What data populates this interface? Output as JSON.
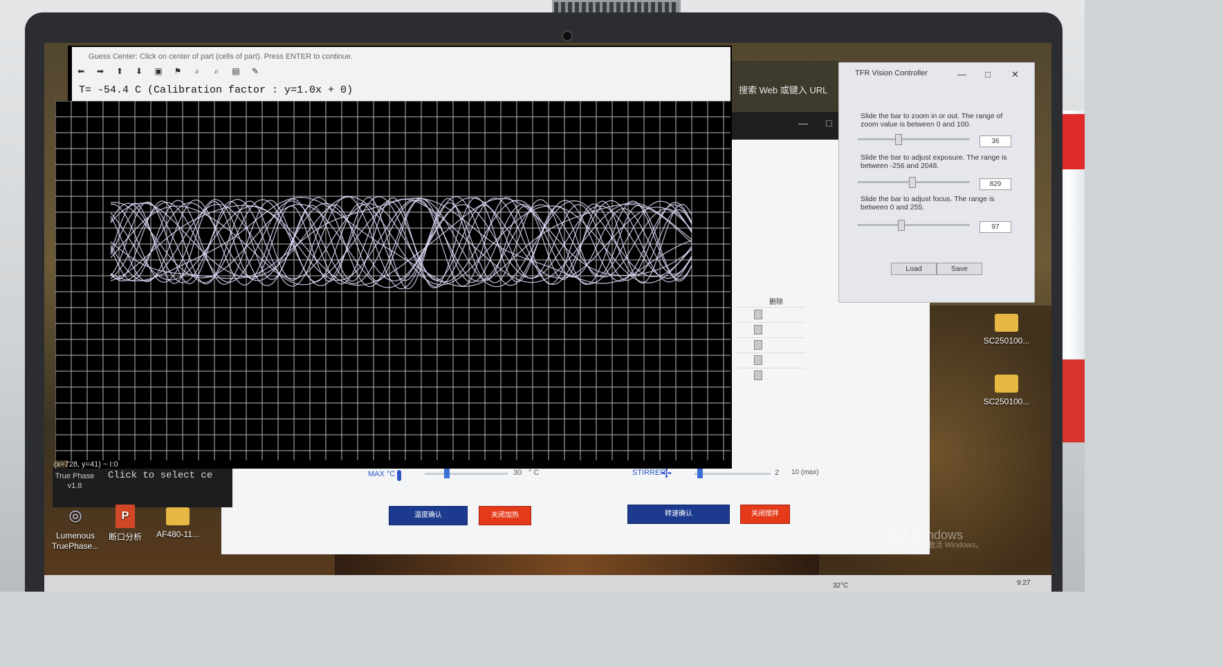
{
  "graph_window": {
    "title": "Guess Center: Click on center of part (cells of part). Press ENTER to continue.",
    "header": "T= -54.4 C    (Calibration factor : y=1.0x + 0)",
    "toolbar_icons": [
      "arrow-left-icon",
      "arrow-right-icon",
      "arrow-up-icon",
      "arrow-down-icon",
      "box-icon",
      "comment-icon",
      "zoom-in-icon",
      "zoom-out-icon",
      "save-icon",
      "brush-icon"
    ],
    "status": "(x=728, y=41) ~ I:0",
    "win_ctrl": [
      "—",
      "□",
      "✕"
    ]
  },
  "terminal": {
    "side_label_1": "True Phase",
    "side_label_2": "v1.8",
    "text": "Click to select ce"
  },
  "browser": {
    "address_placeholder": "搜索 Web 或键入 URL"
  },
  "app_window": {
    "table_header": "删除",
    "max_label": "MAX °C",
    "max_value": "30",
    "max_unit": "° C",
    "stirrer_label": "STIRRER",
    "stirrer_value": "2",
    "stirrer_max": "10  (max)",
    "btn_confirm_temp": "温度确认",
    "btn_close_heat": "关闭加热",
    "btn_confirm_speed": "转速确认",
    "btn_close_stir": "关闭搅拌"
  },
  "tfr": {
    "title": "TFR Vision Controller",
    "zoom_text": "Slide the bar to zoom in or out. The range of zoom value is between 0 and 100.",
    "zoom_value": "36",
    "zoom_level": 0.36,
    "exposure_text": "Slide the bar to adjust exposure. The range is between -256 and 2048.",
    "exposure_value": "829",
    "focus_text": "Slide the bar to adjust focus. The range is between 0 and 255.",
    "focus_value": "97",
    "load": "Load",
    "save": "Save",
    "ctrl": [
      "—",
      "□",
      "✕"
    ]
  },
  "desktop": {
    "icons": [
      {
        "label": "Lumenous TruePhase...",
        "kind": "lum"
      },
      {
        "label": "断口分析",
        "kind": "ppt"
      },
      {
        "label": "AF480-11...",
        "kind": "folder"
      },
      {
        "label": "SC250100...",
        "kind": "folder"
      },
      {
        "label": "SC250100...",
        "kind": "folder"
      }
    ],
    "watermark": "激活 Windows",
    "watermark_sub": "转到\"设置\"以激活 Windows。"
  },
  "taskbar": {
    "temp": "32°C",
    "time": "9:27"
  },
  "colors": {
    "graph_bg": "#000000",
    "grid": "#bcbcbc",
    "trace": "#e6e0ff",
    "blue_button": "#1c3b8f",
    "red_button": "#e43a1a"
  }
}
